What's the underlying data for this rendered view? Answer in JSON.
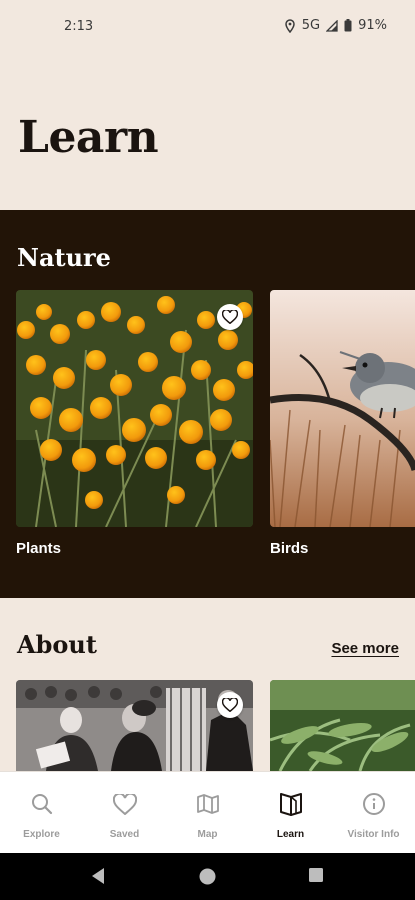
{
  "status_bar": {
    "time": "2:13",
    "network": "5G",
    "battery": "91%"
  },
  "page": {
    "title": "Learn"
  },
  "nature": {
    "heading": "Nature",
    "cards": [
      {
        "label": "Plants",
        "image": "yellow-wildflowers",
        "favorite": false
      },
      {
        "label": "Birds",
        "image": "bird-on-branch",
        "favorite": false
      }
    ]
  },
  "about": {
    "heading": "About",
    "see_more": "See more",
    "cards": [
      {
        "image": "historic-crowd-photo",
        "favorite": false
      },
      {
        "image": "fern-forest"
      }
    ]
  },
  "bottom_nav": {
    "items": [
      {
        "label": "Explore",
        "icon": "search-icon",
        "active": false
      },
      {
        "label": "Saved",
        "icon": "heart-icon",
        "active": false
      },
      {
        "label": "Map",
        "icon": "map-icon",
        "active": false
      },
      {
        "label": "Learn",
        "icon": "book-icon",
        "active": true
      },
      {
        "label": "Visitor Info",
        "icon": "info-icon",
        "active": false
      }
    ]
  },
  "colors": {
    "background": "#f2e8df",
    "dark_section": "#221407",
    "text_primary": "#1b1410",
    "nav_inactive": "#9c9c9c"
  }
}
